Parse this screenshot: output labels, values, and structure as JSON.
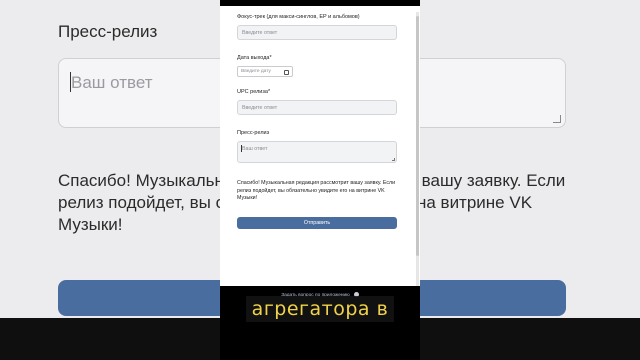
{
  "background": {
    "title": "Пресс-релиз",
    "field_placeholder": "Ваш ответ",
    "text": "Спасибо! Музыкальная редакция рассмотрит вашу заявку. Если релиз подойдет, вы обязательно увидите его на витрине VK Музыки!"
  },
  "form": {
    "focus_track_label": "Фокус-трек (для макси-синглов, EP и альбомов)",
    "focus_track_placeholder": "Введите ответ",
    "release_date_label": "Дата выхода*",
    "release_date_placeholder": "Введите дату",
    "upc_label": "UPC релиза*",
    "upc_placeholder": "Введите ответ",
    "press_label": "Пресс-релиз",
    "press_placeholder": "Ваш ответ",
    "note": "Спасибо! Музыкальная редакция рассмотрит вашу заявку. Если релиз подойдет, вы обязательно увидите его на витрине VK Музыки!",
    "submit_label": "Отправить"
  },
  "footer": {
    "link": "Задать вопрос по приложению"
  },
  "subtitle": "агрегатора в",
  "colors": {
    "accent": "#4a6d9f",
    "subtitle_text": "#f0d24a"
  }
}
